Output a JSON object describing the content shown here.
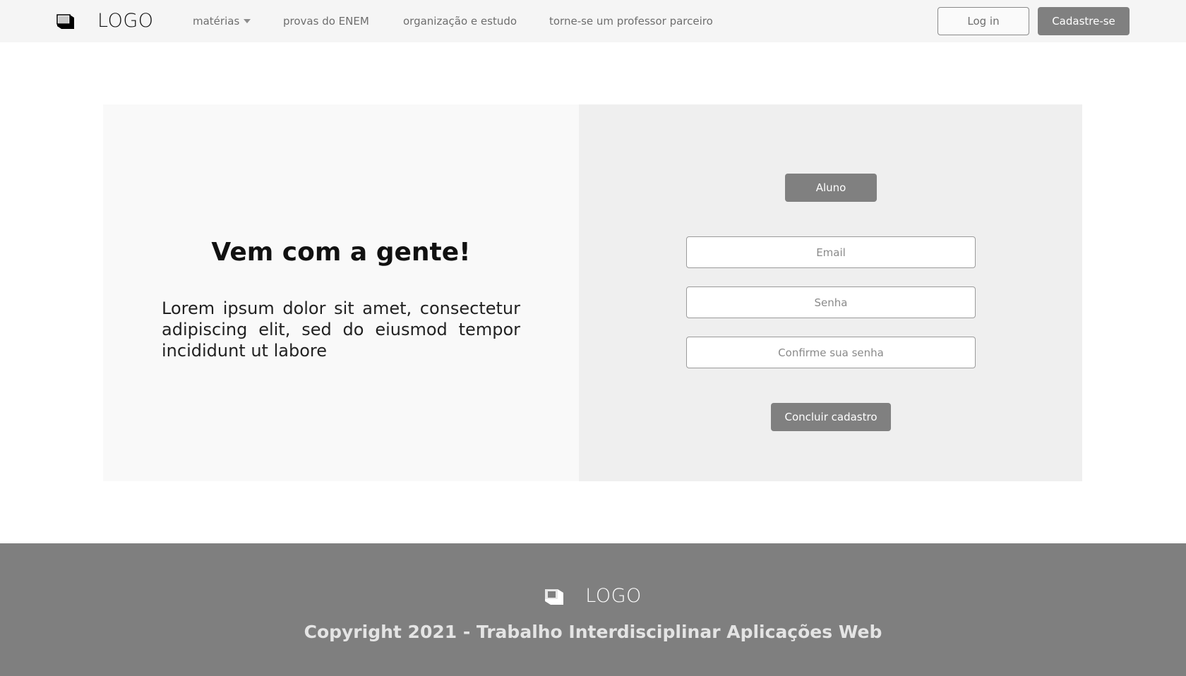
{
  "header": {
    "logo_icon": "logo-cube-icon",
    "logo_text": "LOGO",
    "nav": [
      {
        "label": "matérias",
        "has_dropdown": true
      },
      {
        "label": "provas do ENEM"
      },
      {
        "label": "organização e estudo"
      },
      {
        "label": "torne-se um professor parceiro"
      }
    ],
    "login_label": "Log in",
    "signup_label": "Cadastre-se"
  },
  "intro": {
    "heading": "Vem com a gente!",
    "body": "Lorem ipsum dolor sit amet, consectetur adipiscing elit, sed do eiusmod tempor incididunt ut labore"
  },
  "form": {
    "role_label": "Aluno",
    "email_placeholder": "Email",
    "password_placeholder": "Senha",
    "confirm_placeholder": "Confirme sua senha",
    "submit_label": "Concluir cadastro"
  },
  "footer": {
    "logo_icon": "logo-cube-icon",
    "logo_text": "LOGO",
    "copyright": "Copyright 2021 - Trabalho Interdisciplinar Aplicações Web"
  },
  "colors": {
    "header_bg": "#f5f5f5",
    "button_gray": "#808080",
    "panel_left_bg": "#f9f9f9",
    "panel_right_bg": "#efefef",
    "footer_bg": "#7f7f7f"
  }
}
